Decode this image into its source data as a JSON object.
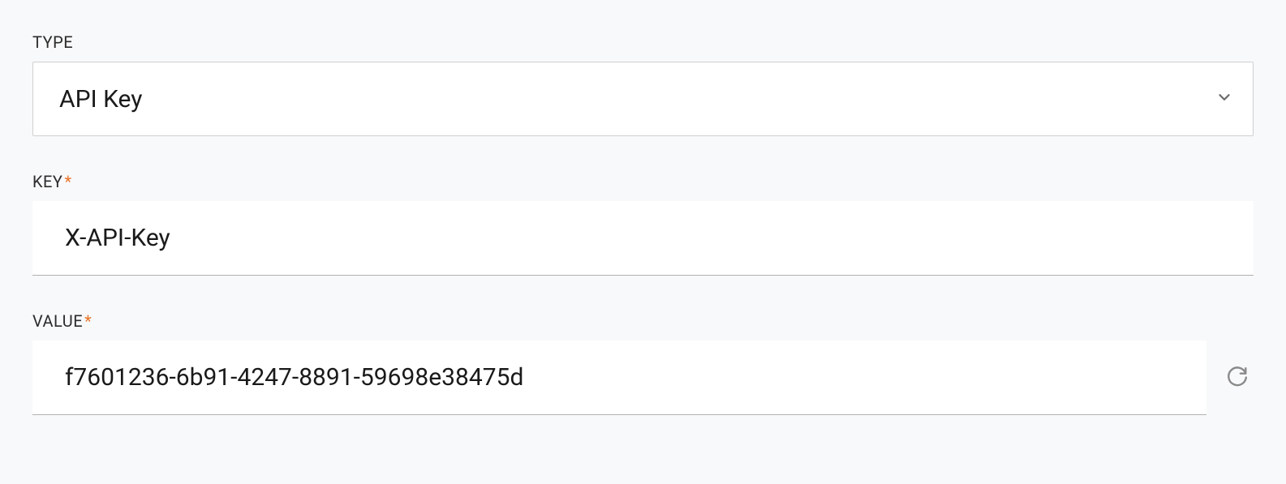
{
  "fields": {
    "type": {
      "label": "TYPE",
      "value": "API Key",
      "required": false
    },
    "key": {
      "label": "KEY",
      "value": "X-API-Key",
      "required": true
    },
    "value": {
      "label": "VALUE",
      "value": "f7601236-6b91-4247-8891-59698e38475d",
      "required": true
    }
  },
  "required_marker": "*"
}
